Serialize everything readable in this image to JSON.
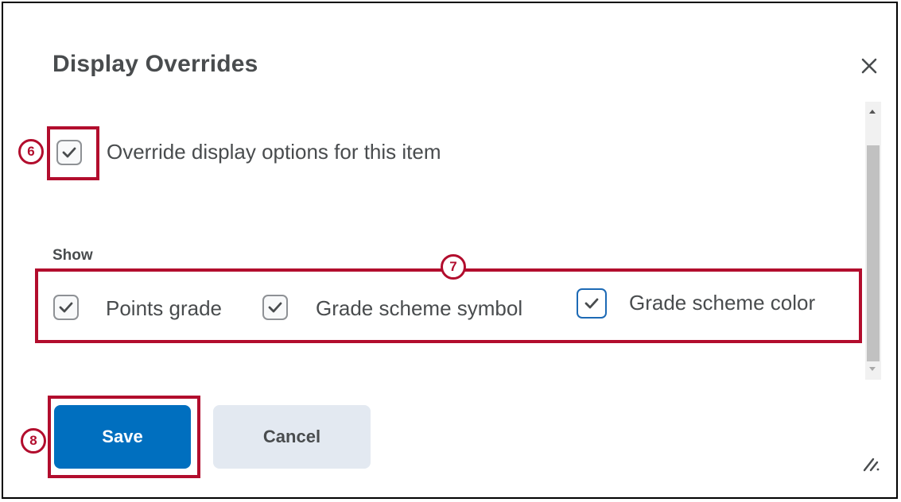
{
  "dialog": {
    "title": "Display Overrides",
    "close_icon": "close-icon"
  },
  "override": {
    "label": "Override display options for this item",
    "checked": true
  },
  "show": {
    "heading": "Show",
    "options": [
      {
        "label": "Points grade",
        "checked": true
      },
      {
        "label": "Grade scheme symbol",
        "checked": true
      },
      {
        "label": "Grade scheme color",
        "checked": true
      }
    ]
  },
  "buttons": {
    "save": "Save",
    "cancel": "Cancel"
  },
  "annotations": {
    "step6": "6",
    "step7": "7",
    "step8": "8"
  },
  "colors": {
    "annotation": "#b20d2d",
    "primary": "#006fbf",
    "focus_border": "#1d6ab5"
  }
}
